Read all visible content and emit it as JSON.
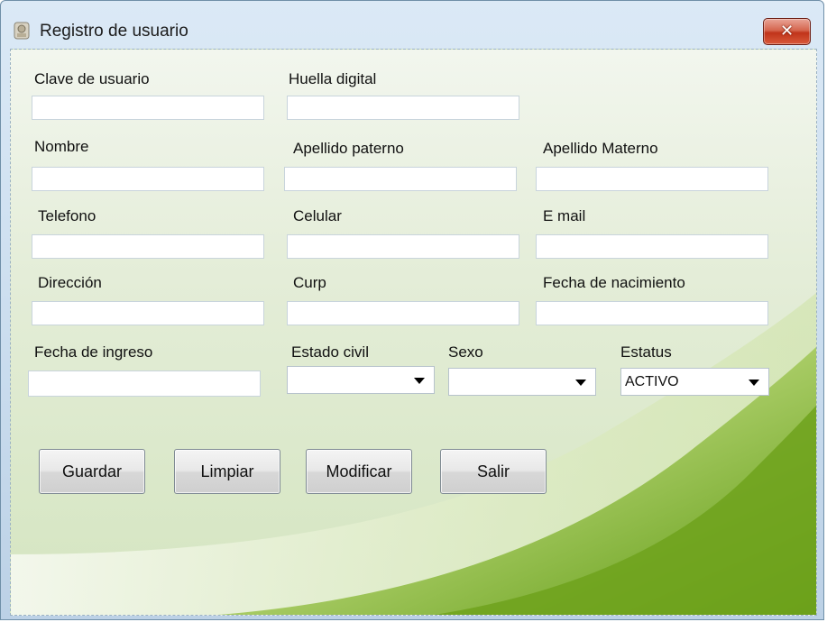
{
  "window": {
    "title": "Registro de usuario",
    "close_glyph": "✕"
  },
  "form": {
    "clave_label": "Clave de usuario",
    "huella_label": "Huella digital",
    "nombre_label": "Nombre",
    "apellido_paterno_label": "Apellido paterno",
    "apellido_materno_label": "Apellido Materno",
    "telefono_label": "Telefono",
    "celular_label": "Celular",
    "email_label": "E mail",
    "direccion_label": "Dirección",
    "curp_label": "Curp",
    "fecha_nacimiento_label": "Fecha de nacimiento",
    "fecha_ingreso_label": "Fecha de ingreso",
    "estado_civil_label": "Estado civil",
    "sexo_label": "Sexo",
    "estatus_label": "Estatus",
    "estado_civil_value": "",
    "sexo_value": "",
    "estatus_value": "ACTIVO"
  },
  "buttons": {
    "guardar": "Guardar",
    "limpiar": "Limpiar",
    "modificar": "Modificar",
    "salir": "Salir"
  },
  "colors": {
    "close_button": "#c0341a",
    "swoosh_green": "#7fae2a"
  }
}
